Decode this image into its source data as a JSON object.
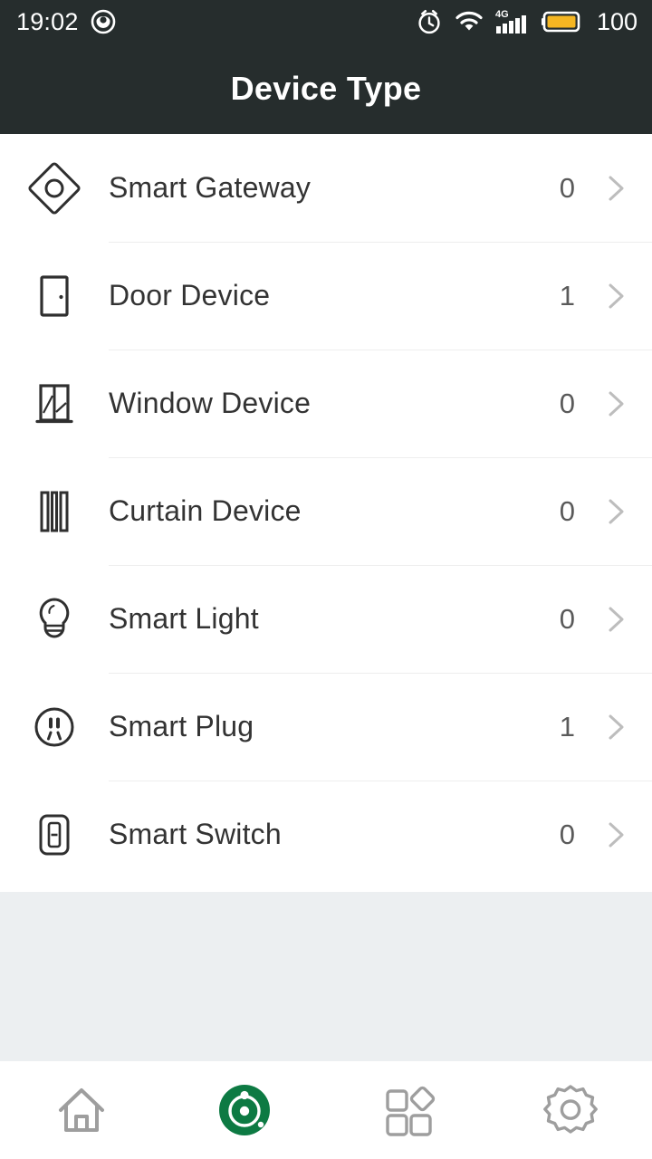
{
  "statusbar": {
    "time": "19:02",
    "notification_icon": "dnd-icon",
    "alarm_icon": "alarm-clock-icon",
    "wifi_icon": "wifi-icon",
    "network_label": "4G",
    "signal_icon": "signal-bars-icon",
    "battery_icon": "battery-icon",
    "battery_level": "100",
    "battery_color": "#f5b622"
  },
  "header": {
    "title": "Device Type",
    "background": "#262d2d",
    "text_color": "#ffffff"
  },
  "list": {
    "chevron_icon": "chevron-right-icon",
    "items": [
      {
        "label": "Smart Gateway",
        "count": "0",
        "icon": "smart-gateway-icon"
      },
      {
        "label": "Door Device",
        "count": "1",
        "icon": "door-device-icon"
      },
      {
        "label": "Window Device",
        "count": "0",
        "icon": "window-device-icon"
      },
      {
        "label": "Curtain Device",
        "count": "0",
        "icon": "curtain-device-icon"
      },
      {
        "label": "Smart Light",
        "count": "0",
        "icon": "smart-light-icon"
      },
      {
        "label": "Smart Plug",
        "count": "1",
        "icon": "smart-plug-icon"
      },
      {
        "label": "Smart Switch",
        "count": "0",
        "icon": "smart-switch-icon"
      }
    ]
  },
  "bottom_nav": {
    "active_color": "#0d7a43",
    "inactive_color": "#9e9e9e",
    "items": [
      {
        "name": "home",
        "icon": "home-icon",
        "active": false
      },
      {
        "name": "devices",
        "icon": "device-hub-icon",
        "active": true
      },
      {
        "name": "scenes",
        "icon": "grid-apps-icon",
        "active": false
      },
      {
        "name": "settings",
        "icon": "gear-icon",
        "active": false
      }
    ]
  }
}
